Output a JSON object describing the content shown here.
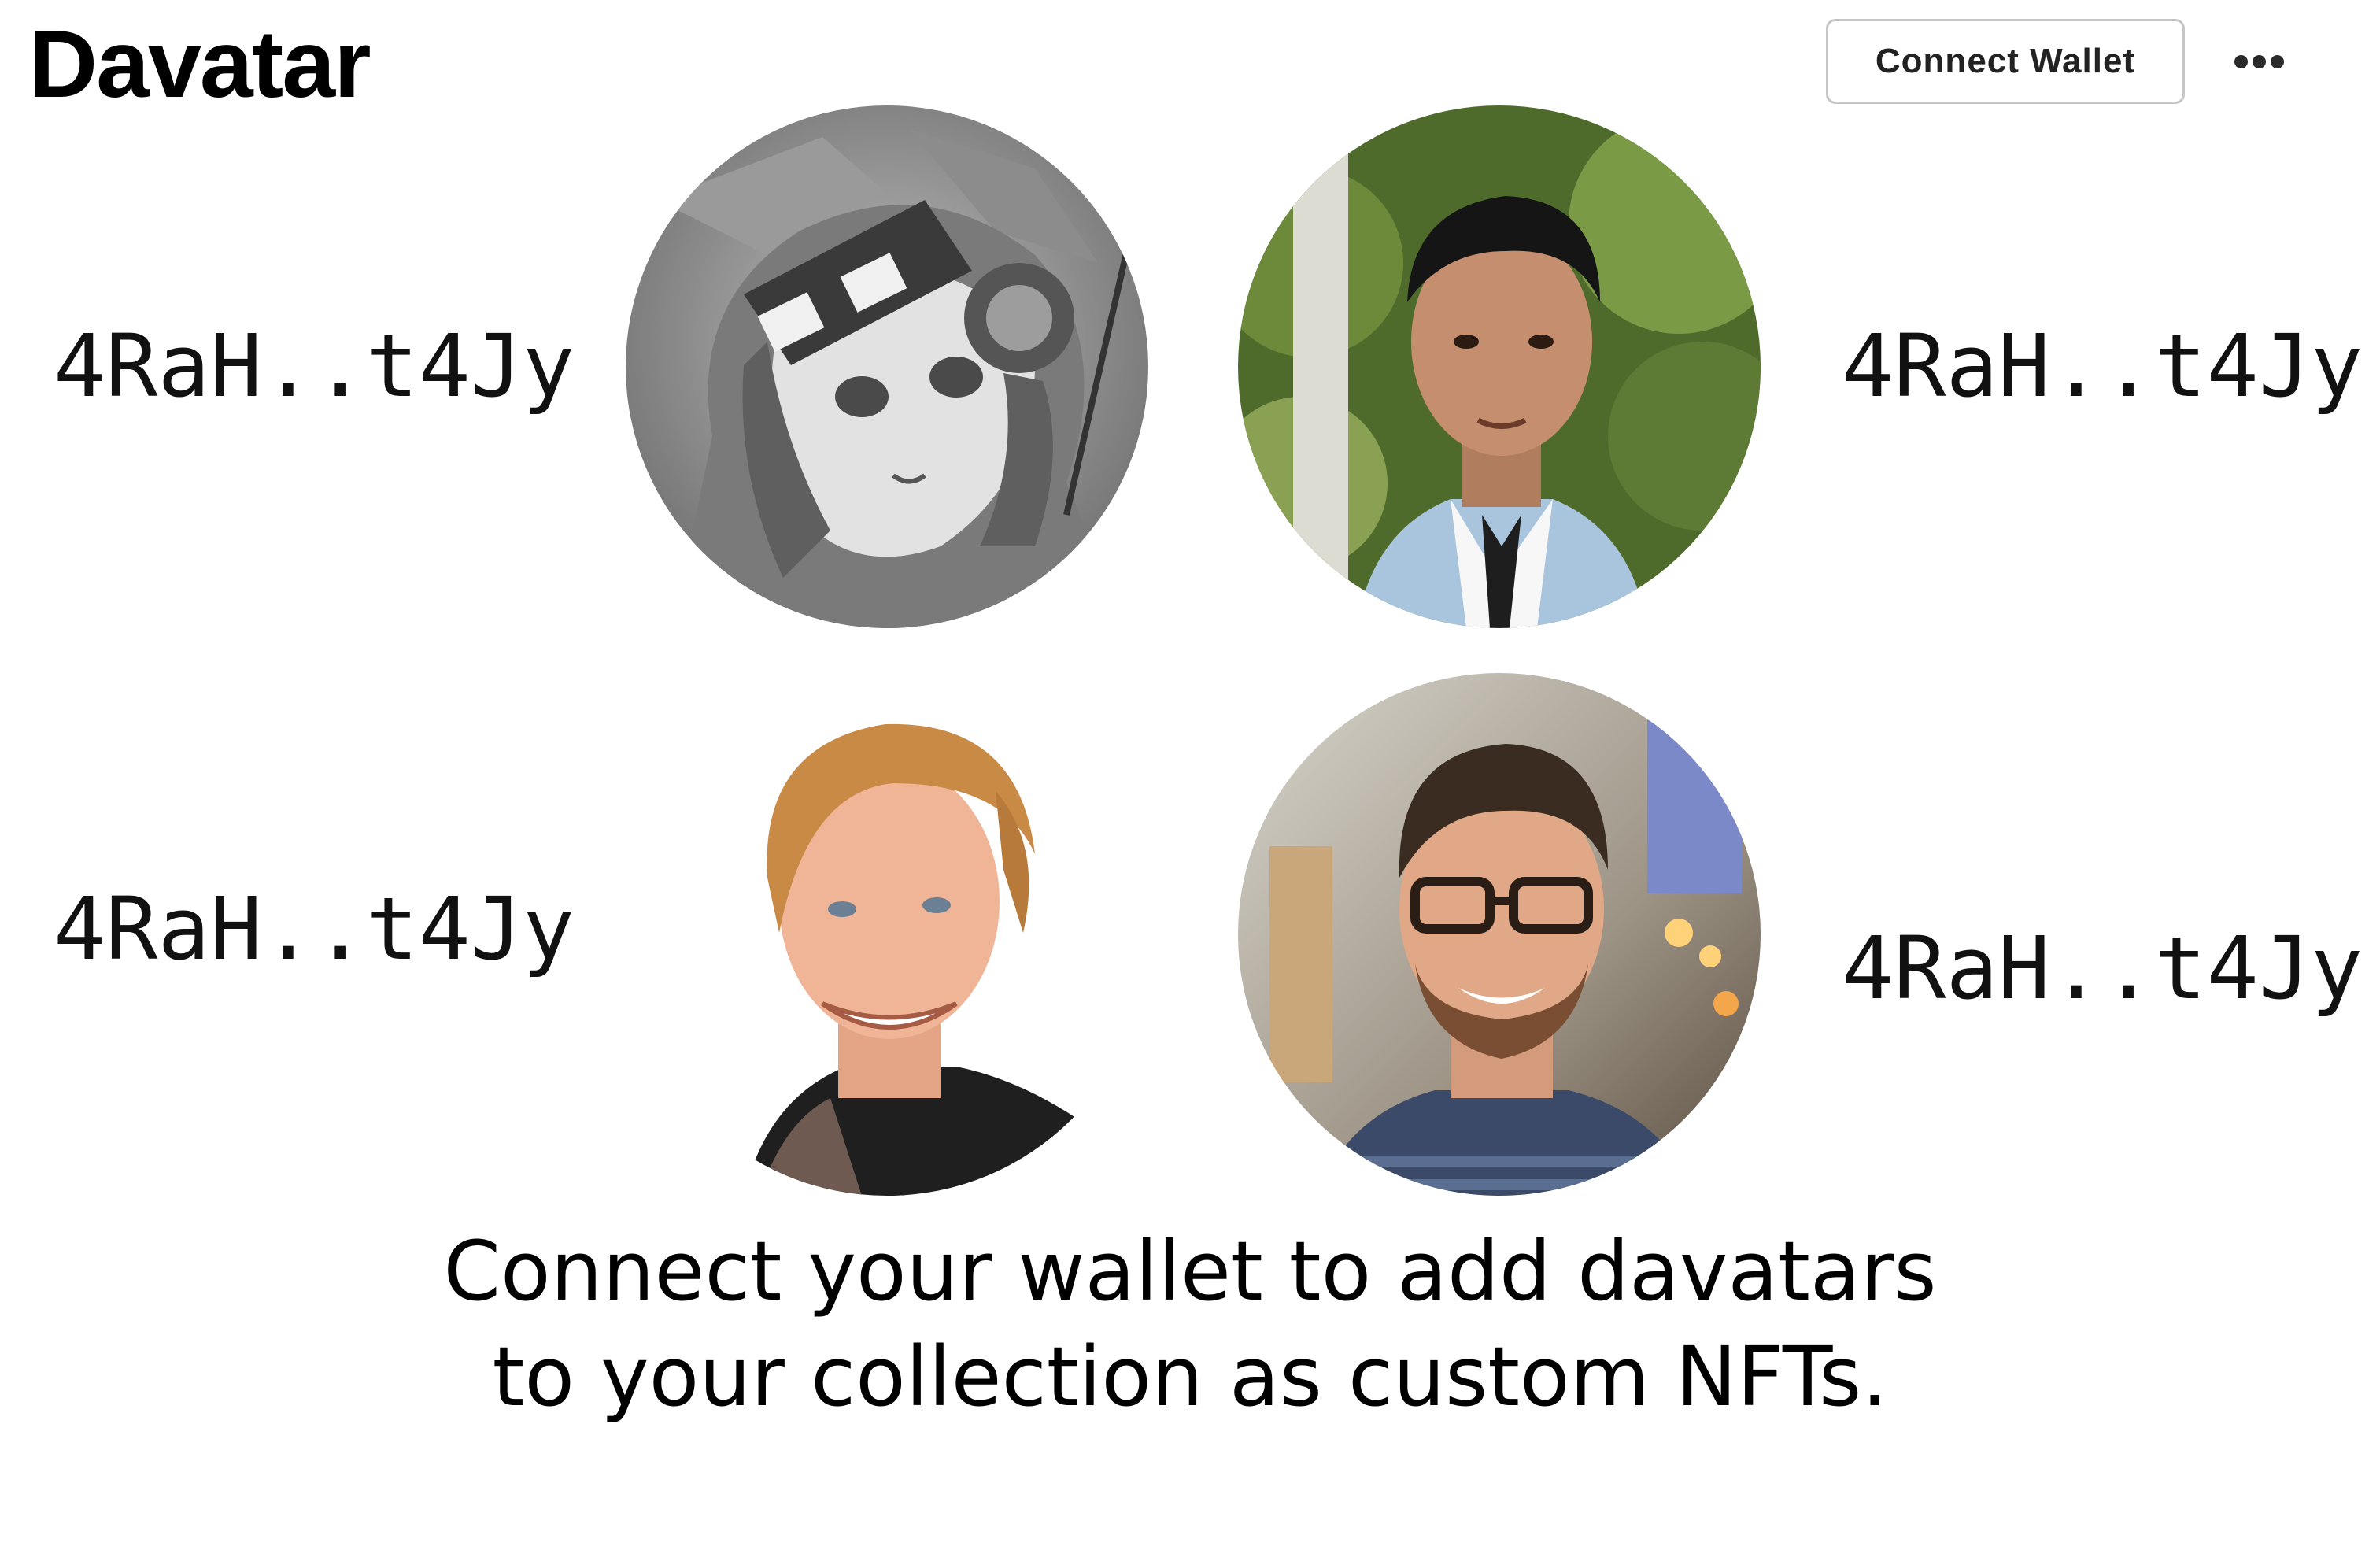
{
  "header": {
    "title": "Davatar",
    "connect_wallet_label": "Connect Wallet",
    "more_icon": "more-horizontal-icon"
  },
  "avatars": [
    {
      "address": "4RaH..t4Jy",
      "image": "anime-character-portrait"
    },
    {
      "address": "4RaH..t4Jy",
      "image": "man-dark-hair-suit-portrait"
    },
    {
      "address": "4RaH..t4Jy",
      "image": "man-blond-hair-smiling-portrait"
    },
    {
      "address": "4RaH..t4Jy",
      "image": "man-beard-glasses-portrait"
    }
  ],
  "message": {
    "line1": "Connect your wallet to add davatars",
    "line2": "to your collection as custom NFTs."
  }
}
